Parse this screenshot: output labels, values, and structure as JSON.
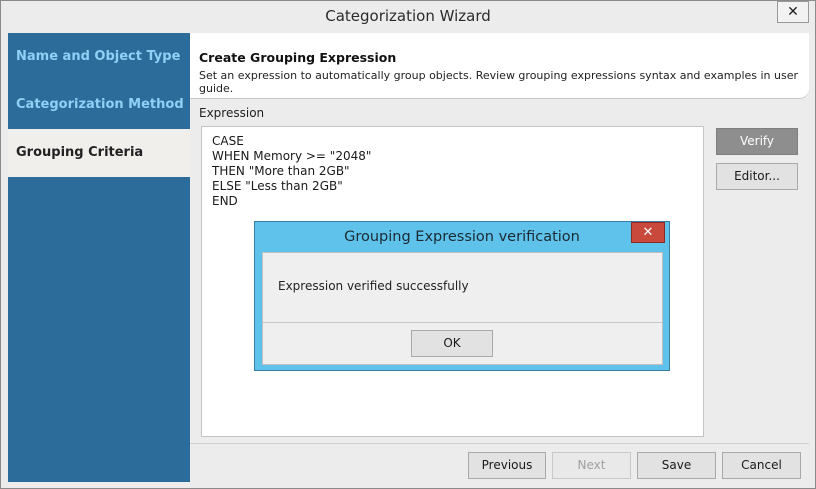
{
  "window": {
    "title": "Categorization Wizard",
    "close_glyph": "✕"
  },
  "sidebar": {
    "items": [
      {
        "label": "Name and Object Type",
        "active": false
      },
      {
        "label": "Categorization Method",
        "active": false
      },
      {
        "label": "Grouping Criteria",
        "active": true
      }
    ]
  },
  "header": {
    "title": "Create Grouping Expression",
    "description": "Set an expression to automatically group objects. Review grouping expressions syntax and examples in user guide."
  },
  "expression": {
    "label": "Expression",
    "lines": [
      "CASE",
      "WHEN Memory >= \"2048\"",
      "THEN \"More than 2GB\"",
      "ELSE \"Less than 2GB\"",
      "END"
    ]
  },
  "side_buttons": {
    "verify": "Verify",
    "editor": "Editor..."
  },
  "footer": {
    "previous": "Previous",
    "next": "Next",
    "save": "Save",
    "cancel": "Cancel"
  },
  "dialog": {
    "title": "Grouping Expression verification",
    "close_glyph": "✕",
    "message": "Expression verified successfully",
    "ok": "OK"
  },
  "colors": {
    "sidebar_bg": "#2b6c9b",
    "sidebar_text": "#8fd0f4",
    "dialog_frame": "#5ec2ea",
    "dialog_close": "#c94a3d",
    "verify_bg": "#8e8e8e"
  }
}
